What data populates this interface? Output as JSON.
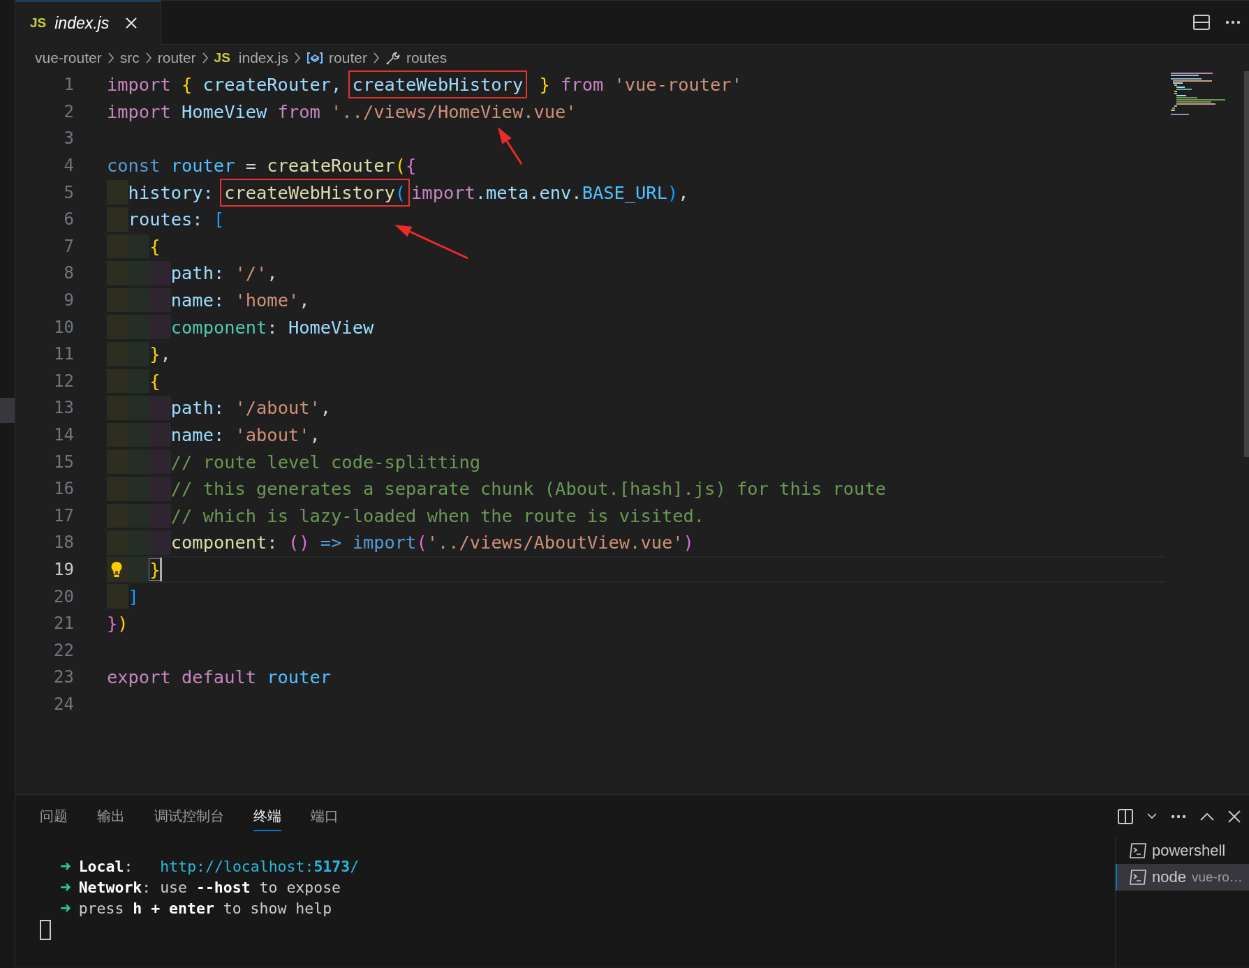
{
  "tabs": [
    {
      "badge": "JS",
      "label": "index.js",
      "selected": true
    }
  ],
  "breadcrumb": [
    {
      "kind": "folder",
      "label": "vue-router"
    },
    {
      "kind": "folder",
      "label": "src"
    },
    {
      "kind": "folder",
      "label": "router"
    },
    {
      "kind": "file",
      "badge": "JS",
      "label": "index.js"
    },
    {
      "kind": "variable",
      "label": "router"
    },
    {
      "kind": "property",
      "label": "routes"
    }
  ],
  "editor": {
    "lines": [
      {
        "number": "1",
        "current": false,
        "tokens": [
          {
            "text": "import ",
            "kind": "control"
          },
          {
            "text": "{ ",
            "kind": "brace1"
          },
          {
            "text": "createRouter, ",
            "kind": "var"
          },
          {
            "kind": "boxed",
            "tokens": [
              {
                "text": "createWebHistory",
                "kind": "var"
              }
            ]
          },
          {
            "text": " }",
            "kind": "brace1"
          },
          {
            "text": " from",
            "kind": "control"
          },
          {
            "text": " 'vue-router'",
            "kind": "string"
          }
        ]
      },
      {
        "number": "2",
        "current": false,
        "tokens": [
          {
            "text": "import ",
            "kind": "control"
          },
          {
            "text": "HomeView ",
            "kind": "var"
          },
          {
            "text": "from ",
            "kind": "control"
          },
          {
            "text": "'../views/HomeView.vue'",
            "kind": "string"
          }
        ]
      },
      {
        "number": "3",
        "current": false
      },
      {
        "number": "4",
        "current": false,
        "tokens": [
          {
            "text": "const ",
            "kind": "storage"
          },
          {
            "text": "router",
            "kind": "constant"
          },
          {
            "text": " = ",
            "kind": "plain"
          },
          {
            "text": "createRouter",
            "kind": "function"
          },
          {
            "text": "(",
            "kind": "brace1"
          },
          {
            "text": "{",
            "kind": "brace2"
          }
        ]
      },
      {
        "number": "5",
        "current": false,
        "guides": [
          {
            "color": "#2d2d20"
          }
        ],
        "tokens": [
          {
            "text": "history: ",
            "kind": "prop"
          },
          {
            "kind": "boxed",
            "tokens": [
              {
                "text": "createWebHistory",
                "kind": "function"
              },
              {
                "text": "(",
                "kind": "brace3"
              }
            ]
          },
          {
            "text": "import",
            "kind": "control"
          },
          {
            "text": ".meta.env.",
            "kind": "var"
          },
          {
            "text": "BASE_URL",
            "kind": "constant"
          },
          {
            "text": ")",
            "kind": "brace3"
          },
          {
            "text": ",",
            "kind": "plain"
          }
        ]
      },
      {
        "number": "6",
        "current": false,
        "guides": [
          {
            "color": "#2d2d20"
          }
        ],
        "tokens": [
          {
            "text": "routes: ",
            "kind": "prop"
          },
          {
            "text": "[",
            "kind": "brace3"
          }
        ]
      },
      {
        "number": "7",
        "current": false,
        "guides": [
          {
            "color": "#2d2d20"
          },
          {
            "color": "#242d26"
          }
        ],
        "tokens": [
          {
            "text": "{",
            "kind": "brace1"
          }
        ]
      },
      {
        "number": "8",
        "current": false,
        "guides": [
          {
            "color": "#2d2d20"
          },
          {
            "color": "#242d26"
          },
          {
            "color": "#2e2531"
          }
        ],
        "tokens": [
          {
            "text": "path: ",
            "kind": "prop"
          },
          {
            "text": "'/'",
            "kind": "string"
          },
          {
            "text": ",",
            "kind": "plain"
          }
        ]
      },
      {
        "number": "9",
        "current": false,
        "guides": [
          {
            "color": "#2d2d20"
          },
          {
            "color": "#242d26"
          },
          {
            "color": "#2e2531"
          }
        ],
        "tokens": [
          {
            "text": "name: ",
            "kind": "prop"
          },
          {
            "text": "'home'",
            "kind": "string"
          },
          {
            "text": ",",
            "kind": "plain"
          }
        ]
      },
      {
        "number": "10",
        "current": false,
        "guides": [
          {
            "color": "#2d2d20"
          },
          {
            "color": "#242d26"
          },
          {
            "color": "#2e2531"
          }
        ],
        "tokens": [
          {
            "text": "component",
            "kind": "type"
          },
          {
            "text": ": ",
            "kind": "plain"
          },
          {
            "text": "HomeView",
            "kind": "var"
          }
        ]
      },
      {
        "number": "11",
        "current": false,
        "guides": [
          {
            "color": "#2d2d20"
          },
          {
            "color": "#242d26"
          }
        ],
        "tokens": [
          {
            "text": "}",
            "kind": "brace1"
          },
          {
            "text": ",",
            "kind": "plain"
          }
        ]
      },
      {
        "number": "12",
        "current": false,
        "guides": [
          {
            "color": "#2d2d20"
          },
          {
            "color": "#242d26"
          }
        ],
        "tokens": [
          {
            "text": "{",
            "kind": "brace1"
          }
        ]
      },
      {
        "number": "13",
        "current": false,
        "guides": [
          {
            "color": "#2d2d20"
          },
          {
            "color": "#242d26"
          },
          {
            "color": "#2e2531"
          }
        ],
        "tokens": [
          {
            "text": "path: ",
            "kind": "prop"
          },
          {
            "text": "'/about'",
            "kind": "string"
          },
          {
            "text": ",",
            "kind": "plain"
          }
        ]
      },
      {
        "number": "14",
        "current": false,
        "guides": [
          {
            "color": "#2d2d20"
          },
          {
            "color": "#242d26"
          },
          {
            "color": "#2e2531"
          }
        ],
        "tokens": [
          {
            "text": "name: ",
            "kind": "prop"
          },
          {
            "text": "'about'",
            "kind": "string"
          },
          {
            "text": ",",
            "kind": "plain"
          }
        ]
      },
      {
        "number": "15",
        "current": false,
        "guides": [
          {
            "color": "#2d2d20"
          },
          {
            "color": "#242d26"
          },
          {
            "color": "#2e2531"
          }
        ],
        "tokens": [
          {
            "text": "// route level code-splitting",
            "kind": "comment"
          }
        ]
      },
      {
        "number": "16",
        "current": false,
        "guides": [
          {
            "color": "#2d2d20"
          },
          {
            "color": "#242d26"
          },
          {
            "color": "#2e2531"
          }
        ],
        "tokens": [
          {
            "text": "// this generates a separate chunk (About.[hash].js) for this route",
            "kind": "comment"
          }
        ]
      },
      {
        "number": "17",
        "current": false,
        "guides": [
          {
            "color": "#2d2d20"
          },
          {
            "color": "#242d26"
          },
          {
            "color": "#2e2531"
          }
        ],
        "tokens": [
          {
            "text": "// which is lazy-loaded when the route is visited.",
            "kind": "comment"
          }
        ]
      },
      {
        "number": "18",
        "current": false,
        "guides": [
          {
            "color": "#2d2d20"
          },
          {
            "color": "#242d26"
          },
          {
            "color": "#2e2531"
          }
        ],
        "tokens": [
          {
            "text": "component",
            "kind": "function"
          },
          {
            "text": ": ",
            "kind": "plain"
          },
          {
            "text": "() ",
            "kind": "brace2"
          },
          {
            "text": "=> import",
            "kind": "storage"
          },
          {
            "text": "(",
            "kind": "brace2"
          },
          {
            "text": "'../views/AboutView.vue'",
            "kind": "string"
          },
          {
            "text": ")",
            "kind": "brace2"
          }
        ]
      },
      {
        "number": "19",
        "current": true,
        "gutter": {
          "kind": "lightbulb"
        },
        "guides": [
          {
            "color": "#2d2d20"
          },
          {
            "color": "#242d26"
          }
        ],
        "tokens": [
          {
            "kind": "bracket-match",
            "tokens": [
              {
                "text": "}",
                "kind": "brace1"
              }
            ]
          }
        ]
      },
      {
        "number": "20",
        "current": false,
        "guides": [
          {
            "color": "#2d2d20"
          }
        ],
        "tokens": [
          {
            "text": "]",
            "kind": "brace3"
          }
        ]
      },
      {
        "number": "21",
        "current": false,
        "tokens": [
          {
            "text": "}",
            "kind": "brace2"
          },
          {
            "text": ")",
            "kind": "brace1"
          }
        ]
      },
      {
        "number": "22",
        "current": false
      },
      {
        "number": "23",
        "current": false,
        "tokens": [
          {
            "text": "export default ",
            "kind": "control"
          },
          {
            "text": "router",
            "kind": "constant"
          }
        ]
      },
      {
        "number": "24",
        "current": false
      }
    ],
    "annotations": [
      {
        "kind": "arrow"
      },
      {
        "kind": "arrow"
      }
    ]
  },
  "panel": {
    "tabs": [
      {
        "label": "问题",
        "selected": false
      },
      {
        "label": "输出",
        "selected": false
      },
      {
        "label": "调试控制台",
        "selected": false
      },
      {
        "label": "终端",
        "selected": true
      },
      {
        "label": "端口",
        "selected": false
      }
    ],
    "terminal_lines": [
      {
        "prompt": "➜",
        "segments": [
          {
            "kind": "text",
            "text": "**Local**:"
          },
          {
            "kind": "link",
            "text": "http://localhost:**5173**/"
          }
        ]
      },
      {
        "prompt": "➜",
        "segments": [
          {
            "kind": "text",
            "text": "**Network**: use **--host** to expose"
          }
        ]
      },
      {
        "prompt": "➜",
        "segments": [
          {
            "kind": "text",
            "text": "press **h + enter** to show help"
          }
        ]
      }
    ],
    "terminals": [
      {
        "label": "powershell",
        "selected": false
      },
      {
        "label": "node",
        "detail": "vue-ro…",
        "selected": true
      }
    ]
  }
}
